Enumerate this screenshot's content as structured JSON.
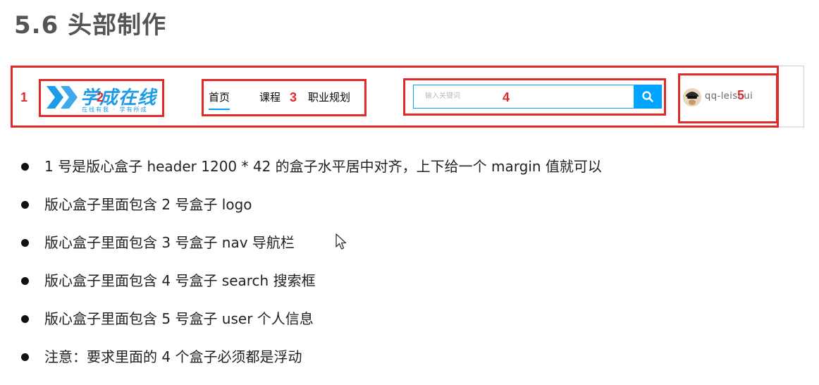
{
  "title": "5.6 头部制作",
  "header_demo": {
    "logo": {
      "text": "学成在线",
      "slogan": "在线有我 · 学有所成"
    },
    "nav": [
      "首页",
      "课程",
      "职业规划"
    ],
    "search": {
      "placeholder": "输入关键词"
    },
    "user": {
      "name": "qq-leishui"
    },
    "labels": [
      "1",
      "2",
      "3",
      "4",
      "5"
    ],
    "colors": {
      "accent": "#00a4ff",
      "annotation": "#e02a2a",
      "logo": "#1d9be6"
    }
  },
  "bullets": [
    "1 号是版心盒子 header 1200 * 42 的盒子水平居中对齐，上下给一个 margin 值就可以",
    "版心盒子里面包含 2 号盒子 logo",
    "版心盒子里面包含 3 号盒子 nav 导航栏",
    "版心盒子里面包含 4 号盒子 search 搜索框",
    "版心盒子里面包含 5 号盒子 user 个人信息",
    "注意：要求里面的 4 个盒子必须都是浮动"
  ],
  "icons": {
    "search": "search-icon",
    "cursor": "mouse-cursor-icon",
    "avatar": "avatar"
  }
}
